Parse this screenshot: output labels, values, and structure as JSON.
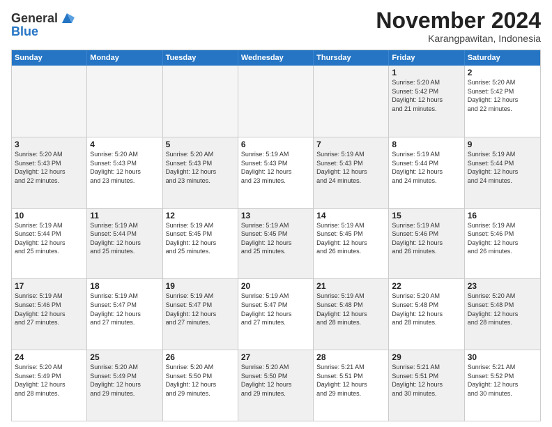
{
  "header": {
    "logo": {
      "line1": "General",
      "line2": "Blue"
    },
    "title": "November 2024",
    "subtitle": "Karangpawitan, Indonesia"
  },
  "days_of_week": [
    "Sunday",
    "Monday",
    "Tuesday",
    "Wednesday",
    "Thursday",
    "Friday",
    "Saturday"
  ],
  "weeks": [
    [
      {
        "day": "",
        "info": "",
        "empty": true
      },
      {
        "day": "",
        "info": "",
        "empty": true
      },
      {
        "day": "",
        "info": "",
        "empty": true
      },
      {
        "day": "",
        "info": "",
        "empty": true
      },
      {
        "day": "",
        "info": "",
        "empty": true
      },
      {
        "day": "1",
        "info": "Sunrise: 5:20 AM\nSunset: 5:42 PM\nDaylight: 12 hours\nand 21 minutes.",
        "shaded": true
      },
      {
        "day": "2",
        "info": "Sunrise: 5:20 AM\nSunset: 5:42 PM\nDaylight: 12 hours\nand 22 minutes.",
        "shaded": false
      }
    ],
    [
      {
        "day": "3",
        "info": "Sunrise: 5:20 AM\nSunset: 5:43 PM\nDaylight: 12 hours\nand 22 minutes.",
        "shaded": true
      },
      {
        "day": "4",
        "info": "Sunrise: 5:20 AM\nSunset: 5:43 PM\nDaylight: 12 hours\nand 23 minutes.",
        "shaded": false
      },
      {
        "day": "5",
        "info": "Sunrise: 5:20 AM\nSunset: 5:43 PM\nDaylight: 12 hours\nand 23 minutes.",
        "shaded": true
      },
      {
        "day": "6",
        "info": "Sunrise: 5:19 AM\nSunset: 5:43 PM\nDaylight: 12 hours\nand 23 minutes.",
        "shaded": false
      },
      {
        "day": "7",
        "info": "Sunrise: 5:19 AM\nSunset: 5:43 PM\nDaylight: 12 hours\nand 24 minutes.",
        "shaded": true
      },
      {
        "day": "8",
        "info": "Sunrise: 5:19 AM\nSunset: 5:44 PM\nDaylight: 12 hours\nand 24 minutes.",
        "shaded": false
      },
      {
        "day": "9",
        "info": "Sunrise: 5:19 AM\nSunset: 5:44 PM\nDaylight: 12 hours\nand 24 minutes.",
        "shaded": true
      }
    ],
    [
      {
        "day": "10",
        "info": "Sunrise: 5:19 AM\nSunset: 5:44 PM\nDaylight: 12 hours\nand 25 minutes.",
        "shaded": false
      },
      {
        "day": "11",
        "info": "Sunrise: 5:19 AM\nSunset: 5:44 PM\nDaylight: 12 hours\nand 25 minutes.",
        "shaded": true
      },
      {
        "day": "12",
        "info": "Sunrise: 5:19 AM\nSunset: 5:45 PM\nDaylight: 12 hours\nand 25 minutes.",
        "shaded": false
      },
      {
        "day": "13",
        "info": "Sunrise: 5:19 AM\nSunset: 5:45 PM\nDaylight: 12 hours\nand 25 minutes.",
        "shaded": true
      },
      {
        "day": "14",
        "info": "Sunrise: 5:19 AM\nSunset: 5:45 PM\nDaylight: 12 hours\nand 26 minutes.",
        "shaded": false
      },
      {
        "day": "15",
        "info": "Sunrise: 5:19 AM\nSunset: 5:46 PM\nDaylight: 12 hours\nand 26 minutes.",
        "shaded": true
      },
      {
        "day": "16",
        "info": "Sunrise: 5:19 AM\nSunset: 5:46 PM\nDaylight: 12 hours\nand 26 minutes.",
        "shaded": false
      }
    ],
    [
      {
        "day": "17",
        "info": "Sunrise: 5:19 AM\nSunset: 5:46 PM\nDaylight: 12 hours\nand 27 minutes.",
        "shaded": true
      },
      {
        "day": "18",
        "info": "Sunrise: 5:19 AM\nSunset: 5:47 PM\nDaylight: 12 hours\nand 27 minutes.",
        "shaded": false
      },
      {
        "day": "19",
        "info": "Sunrise: 5:19 AM\nSunset: 5:47 PM\nDaylight: 12 hours\nand 27 minutes.",
        "shaded": true
      },
      {
        "day": "20",
        "info": "Sunrise: 5:19 AM\nSunset: 5:47 PM\nDaylight: 12 hours\nand 27 minutes.",
        "shaded": false
      },
      {
        "day": "21",
        "info": "Sunrise: 5:19 AM\nSunset: 5:48 PM\nDaylight: 12 hours\nand 28 minutes.",
        "shaded": true
      },
      {
        "day": "22",
        "info": "Sunrise: 5:20 AM\nSunset: 5:48 PM\nDaylight: 12 hours\nand 28 minutes.",
        "shaded": false
      },
      {
        "day": "23",
        "info": "Sunrise: 5:20 AM\nSunset: 5:48 PM\nDaylight: 12 hours\nand 28 minutes.",
        "shaded": true
      }
    ],
    [
      {
        "day": "24",
        "info": "Sunrise: 5:20 AM\nSunset: 5:49 PM\nDaylight: 12 hours\nand 28 minutes.",
        "shaded": false
      },
      {
        "day": "25",
        "info": "Sunrise: 5:20 AM\nSunset: 5:49 PM\nDaylight: 12 hours\nand 29 minutes.",
        "shaded": true
      },
      {
        "day": "26",
        "info": "Sunrise: 5:20 AM\nSunset: 5:50 PM\nDaylight: 12 hours\nand 29 minutes.",
        "shaded": false
      },
      {
        "day": "27",
        "info": "Sunrise: 5:20 AM\nSunset: 5:50 PM\nDaylight: 12 hours\nand 29 minutes.",
        "shaded": true
      },
      {
        "day": "28",
        "info": "Sunrise: 5:21 AM\nSunset: 5:51 PM\nDaylight: 12 hours\nand 29 minutes.",
        "shaded": false
      },
      {
        "day": "29",
        "info": "Sunrise: 5:21 AM\nSunset: 5:51 PM\nDaylight: 12 hours\nand 30 minutes.",
        "shaded": true
      },
      {
        "day": "30",
        "info": "Sunrise: 5:21 AM\nSunset: 5:52 PM\nDaylight: 12 hours\nand 30 minutes.",
        "shaded": false
      }
    ]
  ]
}
